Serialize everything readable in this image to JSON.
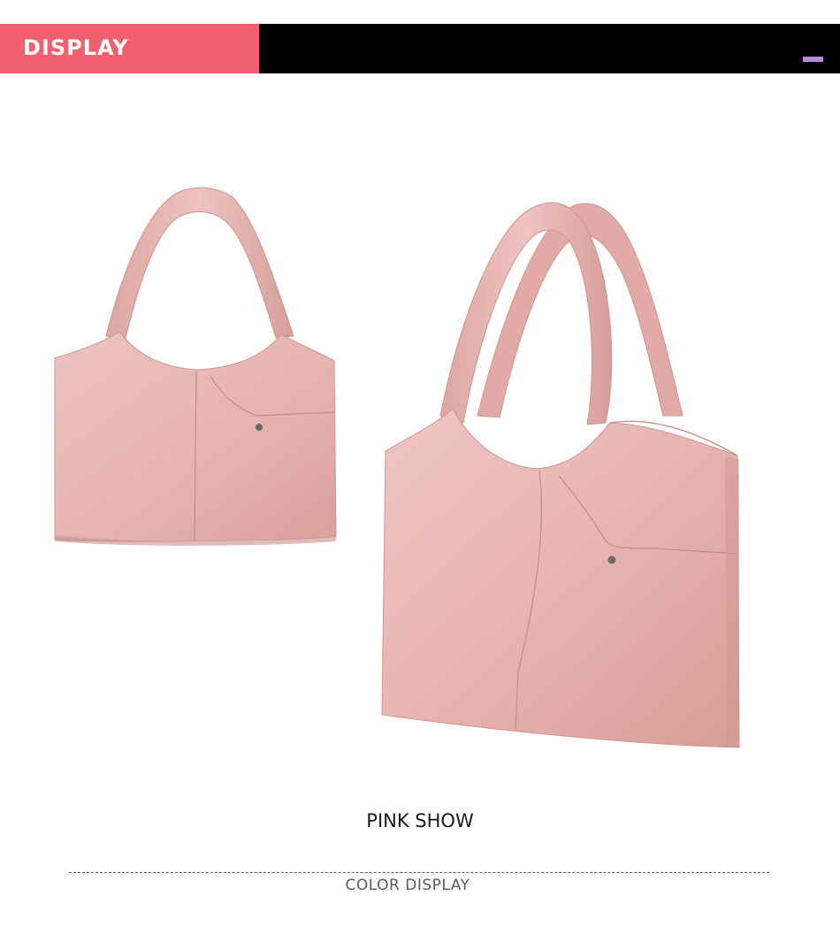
{
  "header": {
    "title": "DISPLAY",
    "tab_color": "#f2606f",
    "bar_color": "#000000",
    "marker_color": "#b58ad6"
  },
  "product": {
    "bag_color": "#e8b6b3",
    "views": [
      "front",
      "three-quarter"
    ]
  },
  "caption": "PINK SHOW",
  "footer": {
    "label": "COLOR DISPLAY"
  }
}
